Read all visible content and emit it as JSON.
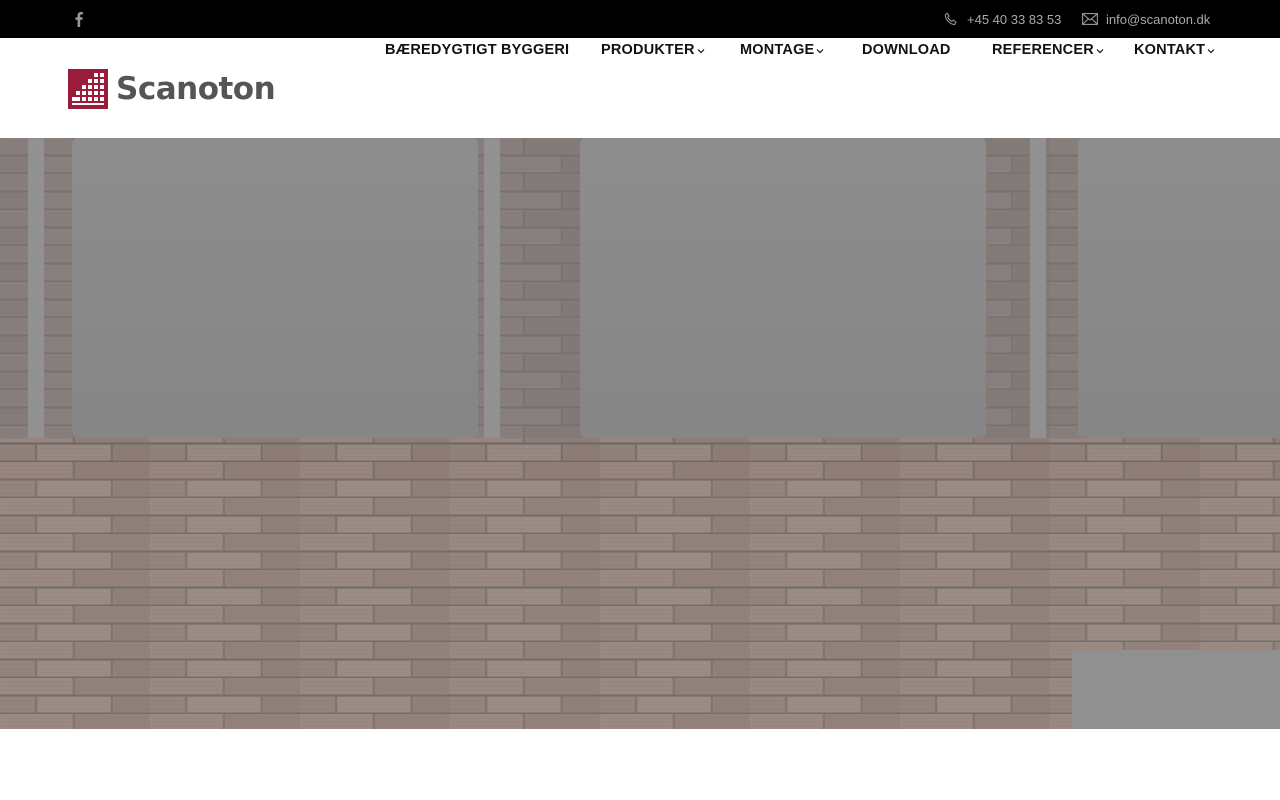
{
  "topbar": {
    "social": [
      {
        "icon": "facebook-icon"
      }
    ],
    "phone": {
      "icon": "phone-icon",
      "text": "+45 40 33 83 53"
    },
    "email": {
      "icon": "mail-icon",
      "text": "info@scanoton.dk"
    }
  },
  "header": {
    "logo": {
      "text": "Scanoton",
      "icon": "scanoton-logo-icon",
      "color": "#9b1b3a"
    }
  },
  "nav": {
    "items": [
      {
        "label": "BÆREDYGTIGT BYGGERI",
        "has_dropdown": false
      },
      {
        "label": "PRODUKTER",
        "has_dropdown": true
      },
      {
        "label": "MONTAGE",
        "has_dropdown": true
      },
      {
        "label": "DOWNLOAD",
        "has_dropdown": false
      },
      {
        "label": "REFERENCER",
        "has_dropdown": true
      },
      {
        "label": "KONTAKT",
        "has_dropdown": true
      }
    ]
  },
  "colors": {
    "topbar_bg": "#000000",
    "brand": "#9b1b3a",
    "nav_text": "#111111",
    "contact_text": "#a9a9a9"
  }
}
